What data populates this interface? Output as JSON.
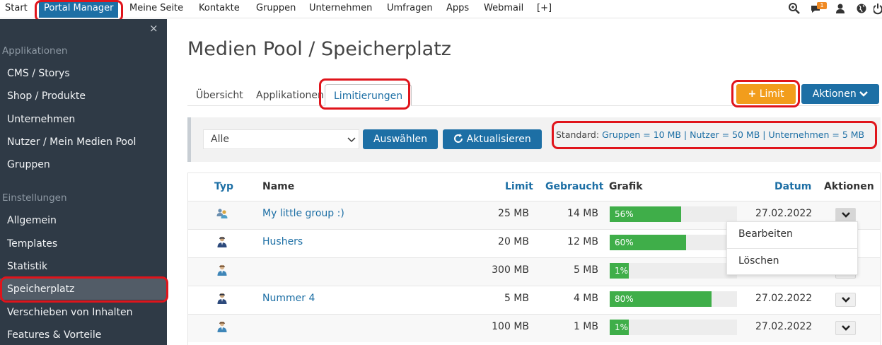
{
  "topnav": {
    "items": [
      "Start",
      "Portal Manager",
      "Meine Seite",
      "Kontakte",
      "Gruppen",
      "Unternehmen",
      "Umfragen",
      "Apps",
      "Webmail",
      "[+]"
    ],
    "notification_count": "1",
    "icons": [
      "search-zoom-icon",
      "chat-icon",
      "user-icon",
      "globe-icon",
      "power-icon"
    ]
  },
  "sidebar": {
    "close": "×",
    "section1": "Applikationen",
    "apps": [
      "CMS / Storys",
      "Shop / Produkte",
      "Unternehmen",
      "Nutzer / Mein Medien Pool",
      "Gruppen"
    ],
    "section2": "Einstellungen",
    "settings": [
      "Allgemein",
      "Templates",
      "Statistik",
      "Speicherplatz",
      "Verschieben von Inhalten",
      "Features & Vorteile"
    ]
  },
  "page": {
    "title": "Medien Pool / Speicherplatz",
    "tabs": [
      "Übersicht",
      "Applikationen",
      "Limitierungen"
    ],
    "add_limit": "Limit",
    "actions": "Aktionen"
  },
  "filter": {
    "select_value": "Alle",
    "select_btn": "Auswählen",
    "refresh_btn": "Aktualisieren",
    "standard_label": "Standard:",
    "standard_value": "Gruppen = 10 MB | Nutzer = 50 MB | Unternehmen = 5 MB"
  },
  "table": {
    "headers": {
      "type": "Typ",
      "name": "Name",
      "limit": "Limit",
      "used": "Gebraucht",
      "graph": "Grafik",
      "date": "Datum",
      "actions": "Aktionen"
    },
    "rows": [
      {
        "type": "group",
        "name": "My little group :)",
        "limit": "25 MB",
        "used": "14 MB",
        "percent": "56%",
        "fill": 0.56,
        "date": "27.02.2022"
      },
      {
        "type": "user",
        "name": "Hushers",
        "limit": "20 MB",
        "used": "12 MB",
        "percent": "60%",
        "fill": 0.6,
        "date": ""
      },
      {
        "type": "user-light",
        "name": "",
        "limit": "300 MB",
        "used": "5 MB",
        "percent": "1%",
        "fill": 0.01,
        "date": ""
      },
      {
        "type": "user",
        "name": "Nummer 4",
        "limit": "5 MB",
        "used": "4 MB",
        "percent": "80%",
        "fill": 0.8,
        "date": "27.02.2022"
      },
      {
        "type": "user-light",
        "name": "",
        "limit": "100 MB",
        "used": "1 MB",
        "percent": "1%",
        "fill": 0.01,
        "date": "27.02.2022"
      }
    ]
  },
  "dropdown": {
    "items": [
      "Bearbeiten",
      "Löschen"
    ]
  },
  "colors": {
    "accent": "#1d6fa5",
    "orange": "#f29d1c",
    "sidebar": "#2f3a46",
    "highlight": "#e0141b",
    "progress": "#3fae49"
  }
}
